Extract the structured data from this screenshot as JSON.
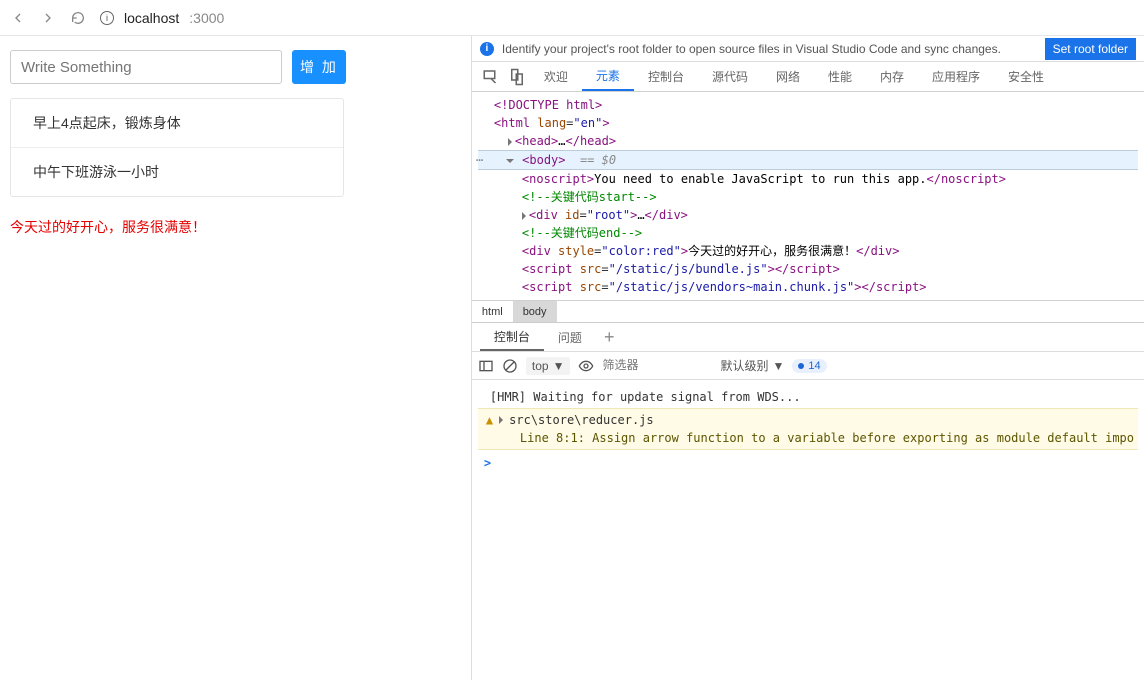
{
  "browser": {
    "url_host": "localhost",
    "url_port": ":3000"
  },
  "app": {
    "input_placeholder": "Write Something",
    "add_button": "增 加",
    "list": [
      "早上4点起床，锻炼身体",
      "中午下班游泳一小时"
    ],
    "red_message": "今天过的好开心，服务很满意！"
  },
  "devtools": {
    "info_text": "Identify your project's root folder to open source files in Visual Studio Code and sync changes.",
    "set_root": "Set root folder",
    "tabs": [
      "欢迎",
      "元素",
      "控制台",
      "源代码",
      "网络",
      "性能",
      "内存",
      "应用程序",
      "安全性"
    ],
    "active_tab": 1,
    "dom": {
      "doctype": "<!DOCTYPE html>",
      "html_open": "<html lang=\"en\">",
      "head": "<head>…</head>",
      "body_open": "<body>",
      "body_eq": "== $0",
      "noscript_text": "You need to enable JavaScript to run this app.",
      "comment_start": "<!--关键代码start-->",
      "root_div": "<div id=\"root\">…</div>",
      "comment_end": "<!--关键代码end-->",
      "red_div_text": "今天过的好开心，服务很满意！",
      "script1": "/static/js/bundle.js",
      "script2": "/static/js/vendors~main.chunk.js"
    },
    "crumbs": [
      "html",
      "body"
    ],
    "console_tabs": [
      "控制台",
      "问题"
    ],
    "toolbar": {
      "context": "top",
      "filter_placeholder": "筛选器",
      "level": "默认级别",
      "badge_count": "14"
    },
    "console": {
      "hmr": "[HMR] Waiting for update signal from WDS...",
      "warn_file": "src\\store\\reducer.js",
      "warn_detail": "Line 8:1:  Assign arrow function to a variable before exporting as module default  impo"
    }
  }
}
